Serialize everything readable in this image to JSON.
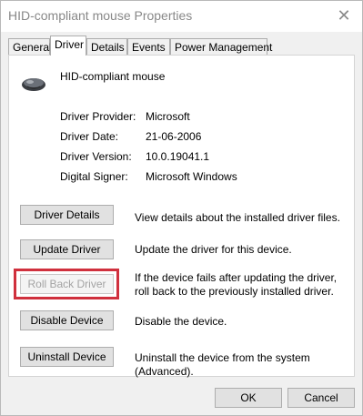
{
  "window": {
    "title": "HID-compliant mouse Properties"
  },
  "tabs": [
    {
      "label": "General"
    },
    {
      "label": "Driver"
    },
    {
      "label": "Details"
    },
    {
      "label": "Events"
    },
    {
      "label": "Power Management"
    }
  ],
  "active_tab": "Driver",
  "device": {
    "name": "HID-compliant mouse",
    "icon": "mouse-icon"
  },
  "driver_info": {
    "provider_label": "Driver Provider:",
    "provider_value": "Microsoft",
    "date_label": "Driver Date:",
    "date_value": "21-06-2006",
    "version_label": "Driver Version:",
    "version_value": "10.0.19041.1",
    "signer_label": "Digital Signer:",
    "signer_value": "Microsoft Windows"
  },
  "actions": {
    "details": {
      "label": "Driver Details",
      "desc": "View details about the installed driver files."
    },
    "update": {
      "label": "Update Driver",
      "desc": "Update the driver for this device."
    },
    "rollback": {
      "label": "Roll Back Driver",
      "desc": "If the device fails after updating the driver, roll back to the previously installed driver.",
      "enabled": false
    },
    "disable": {
      "label": "Disable Device",
      "desc": "Disable the device."
    },
    "uninstall": {
      "label": "Uninstall Device",
      "desc": "Uninstall the device from the system (Advanced)."
    }
  },
  "footer": {
    "ok_label": "OK",
    "cancel_label": "Cancel"
  },
  "colors": {
    "highlight": "#d0303d",
    "disabled_text": "#a3a3a3"
  }
}
